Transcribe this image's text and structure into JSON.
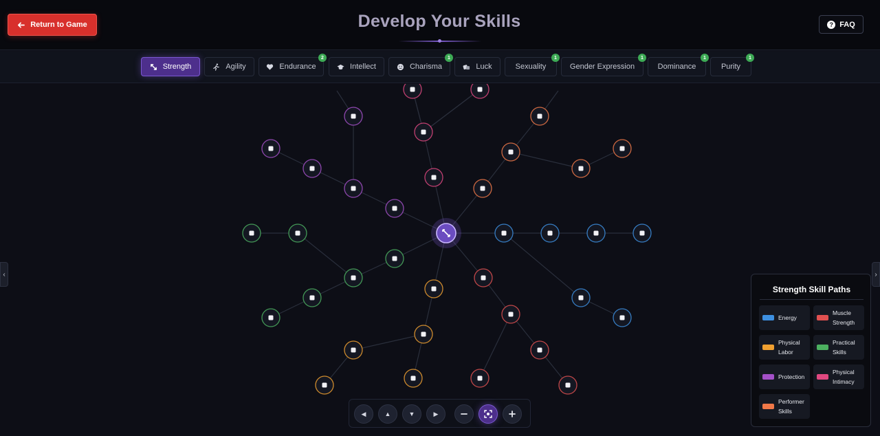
{
  "header": {
    "return_label": "Return to Game",
    "title": "Develop Your Skills",
    "faq_label": "FAQ"
  },
  "tabs": [
    {
      "label": "Strength",
      "icon": "strength-icon",
      "active": true,
      "badge": ""
    },
    {
      "label": "Agility",
      "icon": "running-icon",
      "active": false,
      "badge": ""
    },
    {
      "label": "Endurance",
      "icon": "heart-icon",
      "active": false,
      "badge": "2"
    },
    {
      "label": "Intellect",
      "icon": "graduation-cap-icon",
      "active": false,
      "badge": ""
    },
    {
      "label": "Charisma",
      "icon": "smile-icon",
      "active": false,
      "badge": "1"
    },
    {
      "label": "Luck",
      "icon": "dice-icon",
      "active": false,
      "badge": ""
    },
    {
      "label": "Sexuality",
      "icon": "",
      "active": false,
      "badge": "1"
    },
    {
      "label": "Gender Expression",
      "icon": "",
      "active": false,
      "badge": "1"
    },
    {
      "label": "Dominance",
      "icon": "",
      "active": false,
      "badge": "1"
    },
    {
      "label": "Purity",
      "icon": "",
      "active": false,
      "badge": "1"
    }
  ],
  "legend": {
    "title": "Strength Skill Paths",
    "items": [
      {
        "label": "Energy",
        "color": "#3d8fe0"
      },
      {
        "label": "Muscle Strength",
        "color": "#e05050"
      },
      {
        "label": "Physical Labor",
        "color": "#f0a030"
      },
      {
        "label": "Practical Skills",
        "color": "#4cb060"
      },
      {
        "label": "Protection",
        "color": "#a450c8"
      },
      {
        "label": "Physical Intimacy",
        "color": "#e04880"
      },
      {
        "label": "Performer Skills",
        "color": "#f07848"
      }
    ]
  },
  "controls": [
    {
      "name": "pan-left-button",
      "icon": "caret-left-icon"
    },
    {
      "name": "pan-up-button",
      "icon": "caret-up-icon"
    },
    {
      "name": "pan-down-button",
      "icon": "caret-down-icon"
    },
    {
      "name": "pan-right-button",
      "icon": "caret-right-icon"
    },
    {
      "name": "zoom-out-button",
      "icon": "minus-icon"
    },
    {
      "name": "center-view-button",
      "icon": "focus-icon"
    },
    {
      "name": "zoom-in-button",
      "icon": "plus-icon"
    }
  ],
  "skill_tree": {
    "center": {
      "icon": "strength-icon",
      "color": "#8b6ae0"
    },
    "paths": {
      "energy": "#3d8fe0",
      "muscle_strength": "#e05050",
      "physical_labor": "#f0a030",
      "practical_skills": "#4cb060",
      "protection": "#a450c8",
      "physical_intimacy": "#e04880",
      "performer_skills": "#f07848"
    }
  }
}
